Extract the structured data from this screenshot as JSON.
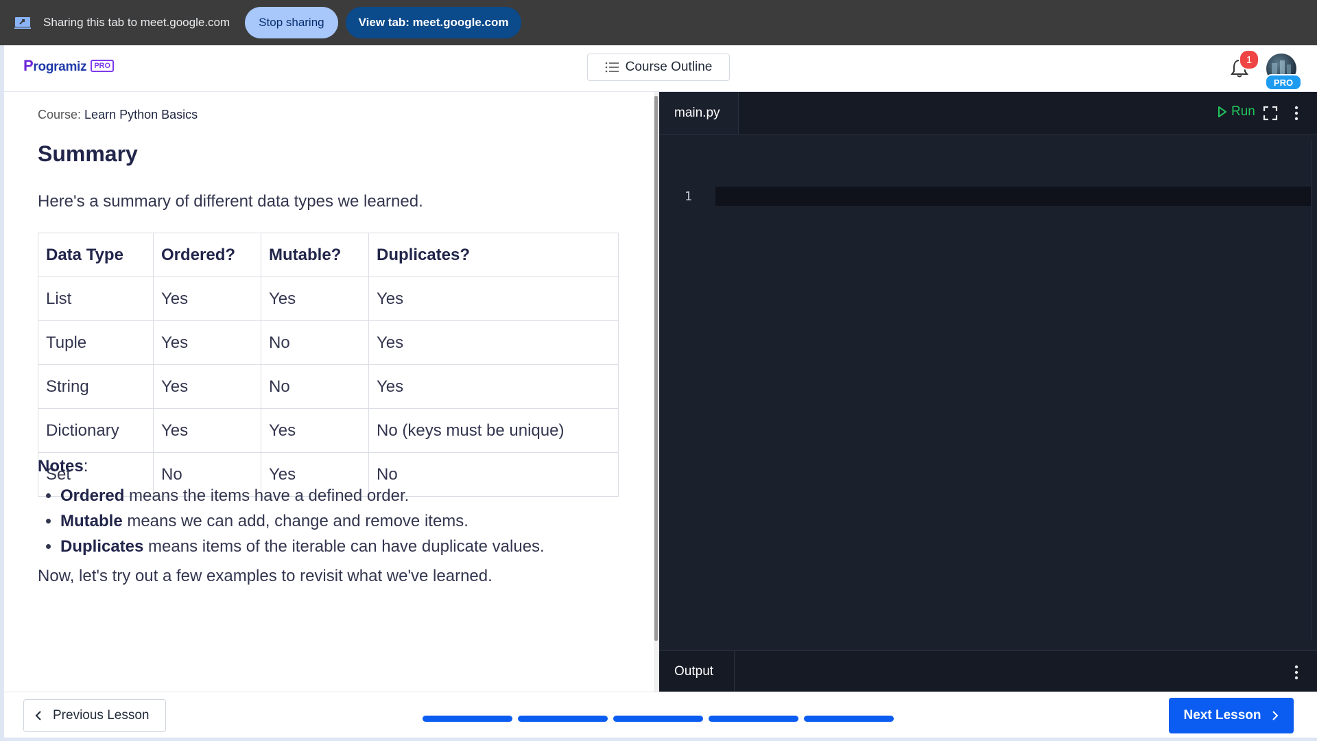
{
  "share_bar": {
    "message": "Sharing this tab to meet.google.com",
    "stop_label": "Stop sharing",
    "view_label": "View tab: meet.google.com"
  },
  "header": {
    "logo_text": "rogramiz",
    "logo_letter": "P",
    "logo_badge": "PRO",
    "outline_label": "Course Outline",
    "notification_count": "1",
    "avatar_badge": "PRO"
  },
  "lesson": {
    "course_prefix": "Course:",
    "course_name": "Learn Python Basics",
    "title": "Summary",
    "intro": "Here's a summary of different data types we learned.",
    "table": {
      "headers": [
        "Data Type",
        "Ordered?",
        "Mutable?",
        "Duplicates?"
      ],
      "rows": [
        [
          "List",
          "Yes",
          "Yes",
          "Yes"
        ],
        [
          "Tuple",
          "Yes",
          "No",
          "Yes"
        ],
        [
          "String",
          "Yes",
          "No",
          "Yes"
        ],
        [
          "Dictionary",
          "Yes",
          "Yes",
          "No (keys must be unique)"
        ],
        [
          "Set",
          "No",
          "Yes",
          "No"
        ]
      ]
    },
    "notes_heading": "Notes",
    "notes_colon": ":",
    "notes": [
      {
        "term": "Ordered",
        "text": " means the items have a defined order."
      },
      {
        "term": "Mutable",
        "text": " means we can add, change and remove items."
      },
      {
        "term": "Duplicates",
        "text": " means items of the iterable can have duplicate values."
      }
    ],
    "outro": "Now, let's try out a few examples to revisit what we've learned."
  },
  "editor": {
    "file_tab": "main.py",
    "run_label": "Run",
    "line_number": "1",
    "output_label": "Output"
  },
  "footer": {
    "prev_label": "Previous Lesson",
    "next_label": "Next Lesson",
    "progress_segments": 5,
    "progress_completed": 5,
    "progress_color": "#0b5cf0"
  },
  "colors": {
    "primary": "#0b5cf0",
    "run_green": "#22c55e",
    "editor_bg": "#1b202d",
    "badge_red": "#ef4444"
  }
}
